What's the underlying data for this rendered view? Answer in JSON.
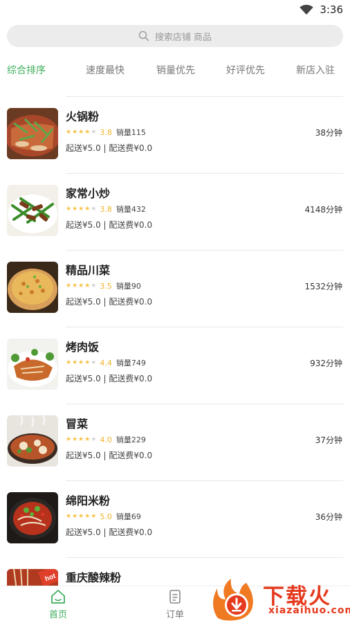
{
  "status_bar": {
    "time": "3:36"
  },
  "search": {
    "placeholder": "搜索店铺 商品"
  },
  "sort_tabs": [
    {
      "label": "综合排序",
      "active": true
    },
    {
      "label": "速度最快",
      "active": false
    },
    {
      "label": "销量优先",
      "active": false
    },
    {
      "label": "好评优先",
      "active": false
    },
    {
      "label": "新店入驻",
      "active": false
    }
  ],
  "shops": [
    {
      "name": "火锅粉",
      "rating": 3.8,
      "rating_text": "3.8",
      "sales": "销量115",
      "time": "38分钟",
      "fees": "起送¥5.0 | 配送费¥0.0"
    },
    {
      "name": "家常小炒",
      "rating": 3.8,
      "rating_text": "3.8",
      "sales": "销量432",
      "time": "4148分钟",
      "fees": "起送¥5.0 | 配送费¥0.0"
    },
    {
      "name": "精品川菜",
      "rating": 3.5,
      "rating_text": "3.5",
      "sales": "销量90",
      "time": "1532分钟",
      "fees": "起送¥5.0 | 配送费¥0.0"
    },
    {
      "name": "烤肉饭",
      "rating": 4.4,
      "rating_text": "4.4",
      "sales": "销量749",
      "time": "932分钟",
      "fees": "起送¥5.0 | 配送费¥0.0"
    },
    {
      "name": "冒菜",
      "rating": 4.0,
      "rating_text": "4.0",
      "sales": "销量229",
      "time": "37分钟",
      "fees": "起送¥5.0 | 配送费¥0.0"
    },
    {
      "name": "绵阳米粉",
      "rating": 5.0,
      "rating_text": "5.0",
      "sales": "销量69",
      "time": "36分钟",
      "fees": "起送¥5.0 | 配送费¥0.0"
    },
    {
      "name": "重庆酸辣粉",
      "rating": null,
      "rating_text": "",
      "sales": "",
      "time": "",
      "fees": ""
    }
  ],
  "bottom_nav": [
    {
      "label": "首页",
      "icon": "home-icon",
      "active": true
    },
    {
      "label": "订单",
      "icon": "order-icon",
      "active": false
    }
  ],
  "watermark": {
    "title": "下载火",
    "subtitle": "xiazaihuo.com"
  },
  "colors": {
    "accent": "#3fae5c",
    "star": "#f6c343",
    "watermark": "#e53a1e"
  }
}
